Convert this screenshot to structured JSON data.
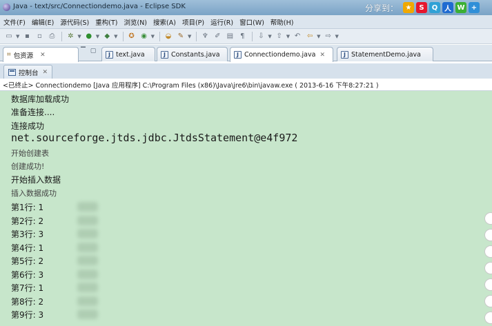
{
  "window": {
    "title": "Java - text/src/Connectiondemo.java - Eclipse SDK"
  },
  "share": {
    "label": "分享到：",
    "icons": [
      {
        "name": "qzone-icon",
        "glyph": "★",
        "color": "#f0a800"
      },
      {
        "name": "weibo-icon",
        "glyph": "S",
        "color": "#e6162d"
      },
      {
        "name": "tencent-weibo-icon",
        "glyph": "Q",
        "color": "#2fa1d6"
      },
      {
        "name": "renren-icon",
        "glyph": "人",
        "color": "#1f6bd1"
      },
      {
        "name": "wechat-icon",
        "glyph": "W",
        "color": "#3cb034"
      },
      {
        "name": "more-share-icon",
        "glyph": "+",
        "color": "#2f8fd8"
      }
    ]
  },
  "menu": [
    "文件(F)",
    "编辑(E)",
    "源代码(S)",
    "重构(T)",
    "浏览(N)",
    "搜索(A)",
    "项目(P)",
    "运行(R)",
    "窗口(W)",
    "帮助(H)"
  ],
  "tabs": {
    "package_explorer": "包资源",
    "editor": [
      "text.java",
      "Constants.java",
      "Connectiondemo.java",
      "StatementDemo.java"
    ],
    "active_editor": "Connectiondemo.java"
  },
  "console": {
    "tab_label": "控制台",
    "status": "<已终止> Connectiondemo [Java 应用程序] C:\\Program Files (x86)\\Java\\jre6\\bin\\javaw.exe ( 2013-6-16 下午8:27:21 )",
    "lines": [
      "数据库加载成功",
      "准备连接....",
      "连接成功",
      "net.sourceforge.jtds.jdbc.JtdsStatement@e4f972",
      "开始创建表",
      "创建成功!",
      "开始插入数据",
      "插入数据成功",
      "第1行: 1",
      "第2行: 2",
      "第3行: 3",
      "第4行: 1",
      "第5行: 2",
      "第6行: 3",
      "第7行: 1",
      "第8行: 2",
      "第9行: 3"
    ]
  },
  "colors": {
    "console_background": "#c7e6cb",
    "title_bar": "#7aa3c6"
  }
}
